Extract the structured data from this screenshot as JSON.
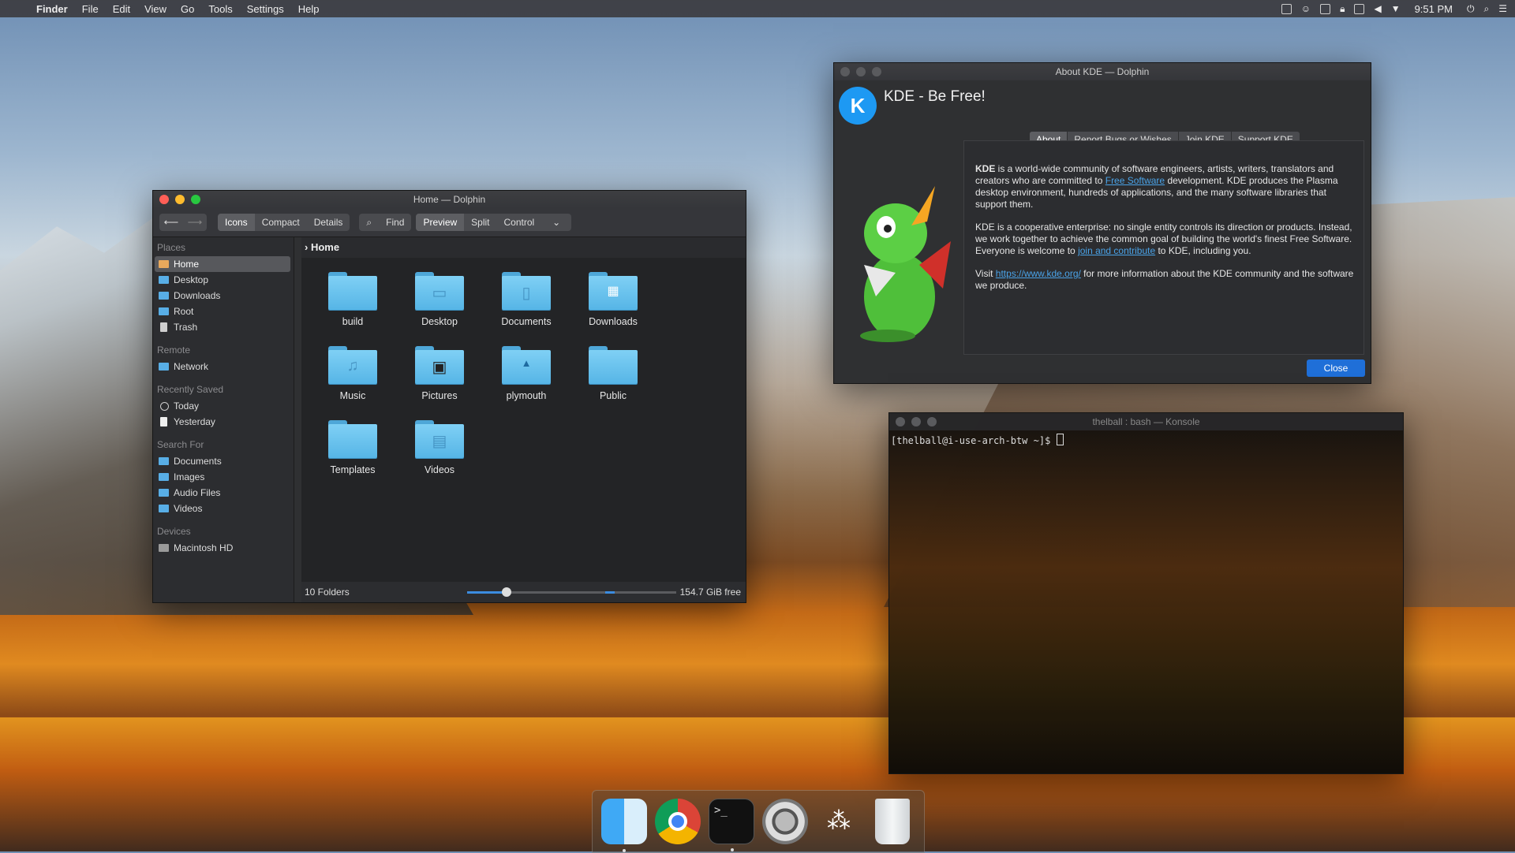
{
  "menubar": {
    "app": "Finder",
    "items": [
      "File",
      "Edit",
      "View",
      "Go",
      "Tools",
      "Settings",
      "Help"
    ],
    "clock": "9:51 PM"
  },
  "dolphin": {
    "title": "Home — Dolphin",
    "view_modes": [
      "Icons",
      "Compact",
      "Details"
    ],
    "find": "Find",
    "toggles": [
      "Preview",
      "Split",
      "Control"
    ],
    "breadcrumb": "Home",
    "sidebar": {
      "places_header": "Places",
      "places": [
        "Home",
        "Desktop",
        "Downloads",
        "Root",
        "Trash"
      ],
      "remote_header": "Remote",
      "remote": [
        "Network"
      ],
      "recent_header": "Recently Saved",
      "recent": [
        "Today",
        "Yesterday"
      ],
      "search_header": "Search For",
      "search": [
        "Documents",
        "Images",
        "Audio Files",
        "Videos"
      ],
      "devices_header": "Devices",
      "devices": [
        "Macintosh HD"
      ]
    },
    "folders": [
      "build",
      "Desktop",
      "Documents",
      "Downloads",
      "Music",
      "Pictures",
      "plymouth",
      "Public",
      "Templates",
      "Videos"
    ],
    "status": "10 Folders",
    "free": "154.7 GiB free"
  },
  "about": {
    "title": "About KDE — Dolphin",
    "heading": "KDE - Be Free!",
    "logo": "K",
    "tabs": [
      "About",
      "Report Bugs or Wishes",
      "Join KDE",
      "Support KDE"
    ],
    "p1_brand": "KDE",
    "p1_a": " is a world-wide community of software engineers, artists, writers, translators and creators who are committed to ",
    "p1_link": "Free Software",
    "p1_b": " development. KDE produces the Plasma desktop environment, hundreds of applications, and the many software libraries that support them.",
    "p2_a": "KDE is a cooperative enterprise: no single entity controls its direction or products. Instead, we work together to achieve the common goal of building the world's finest Free Software. Everyone is welcome to ",
    "p2_link": "join and contribute",
    "p2_b": " to KDE, including you.",
    "p3_a": "Visit ",
    "p3_link": "https://www.kde.org/",
    "p3_b": " for more information about the KDE community and the software we produce.",
    "close": "Close"
  },
  "konsole": {
    "title": "thelball : bash — Konsole",
    "prompt": "[thelball@i-use-arch-btw ~]$ "
  },
  "dock": {
    "terminal_glyph": ">_"
  }
}
